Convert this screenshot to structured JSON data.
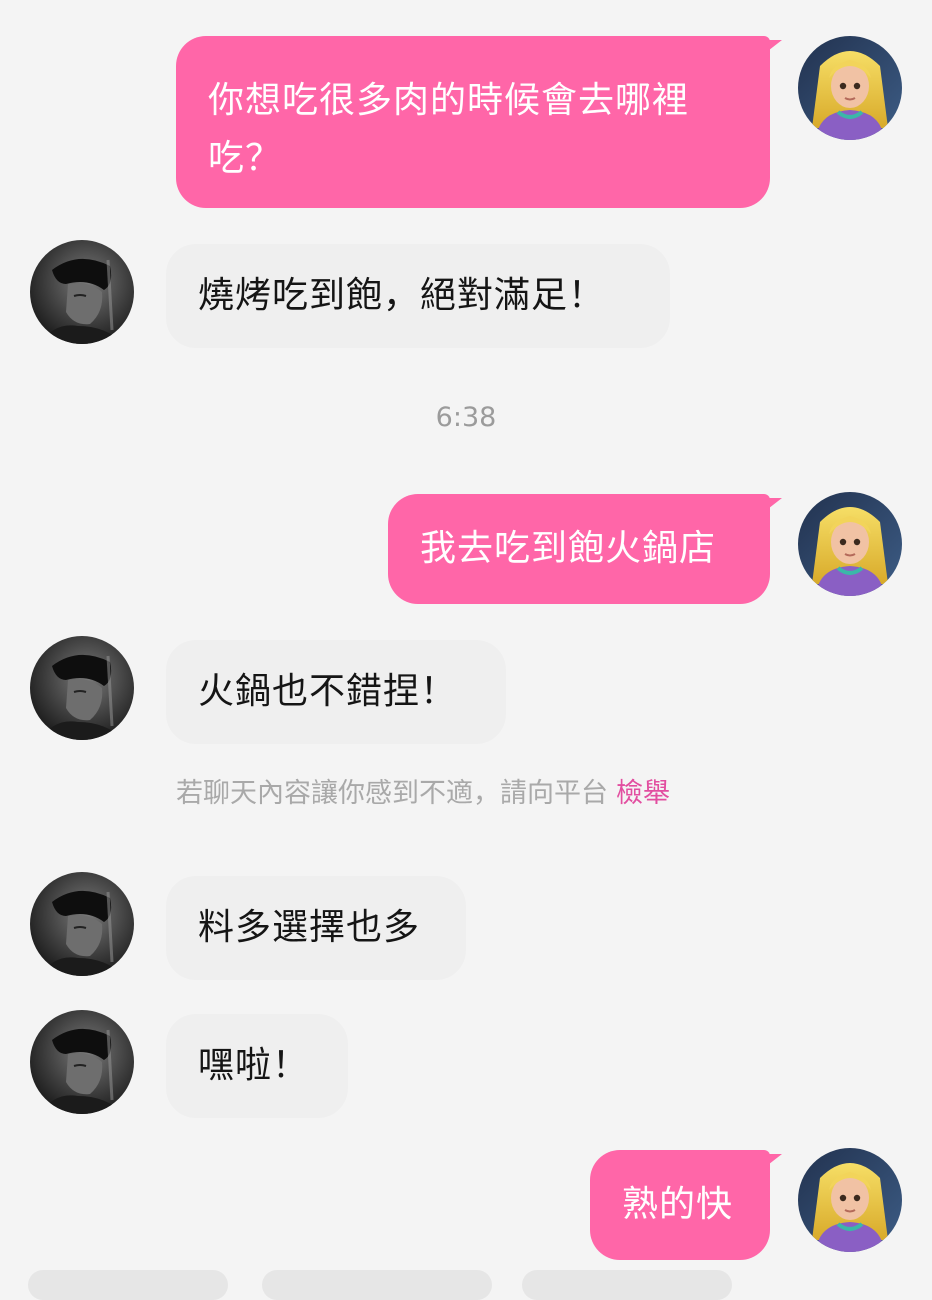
{
  "colors": {
    "outgoing_bubble": "#ff66a8",
    "incoming_bubble": "#efefef",
    "report_link": "#e24ea0",
    "meta_text": "#9b9b9b",
    "background": "#f4f4f4"
  },
  "avatars": {
    "self": "avatar-blonde-girl-icon",
    "partner": "avatar-dark-portrait-icon"
  },
  "messages": [
    {
      "sender": "self",
      "text": "你想吃很多肉的時候會去哪裡吃？"
    },
    {
      "sender": "partner",
      "text": "燒烤吃到飽，絕對滿足！"
    },
    {
      "sender": "self",
      "text": "我去吃到飽火鍋店"
    },
    {
      "sender": "partner",
      "text": "火鍋也不錯捏！"
    },
    {
      "sender": "partner",
      "text": "料多選擇也多"
    },
    {
      "sender": "partner",
      "text": "嘿啦！"
    },
    {
      "sender": "self",
      "text": "熟的快"
    }
  ],
  "timestamp": "6:38",
  "notice": {
    "text": "若聊天內容讓你感到不適，請向平台",
    "link": "檢舉"
  }
}
